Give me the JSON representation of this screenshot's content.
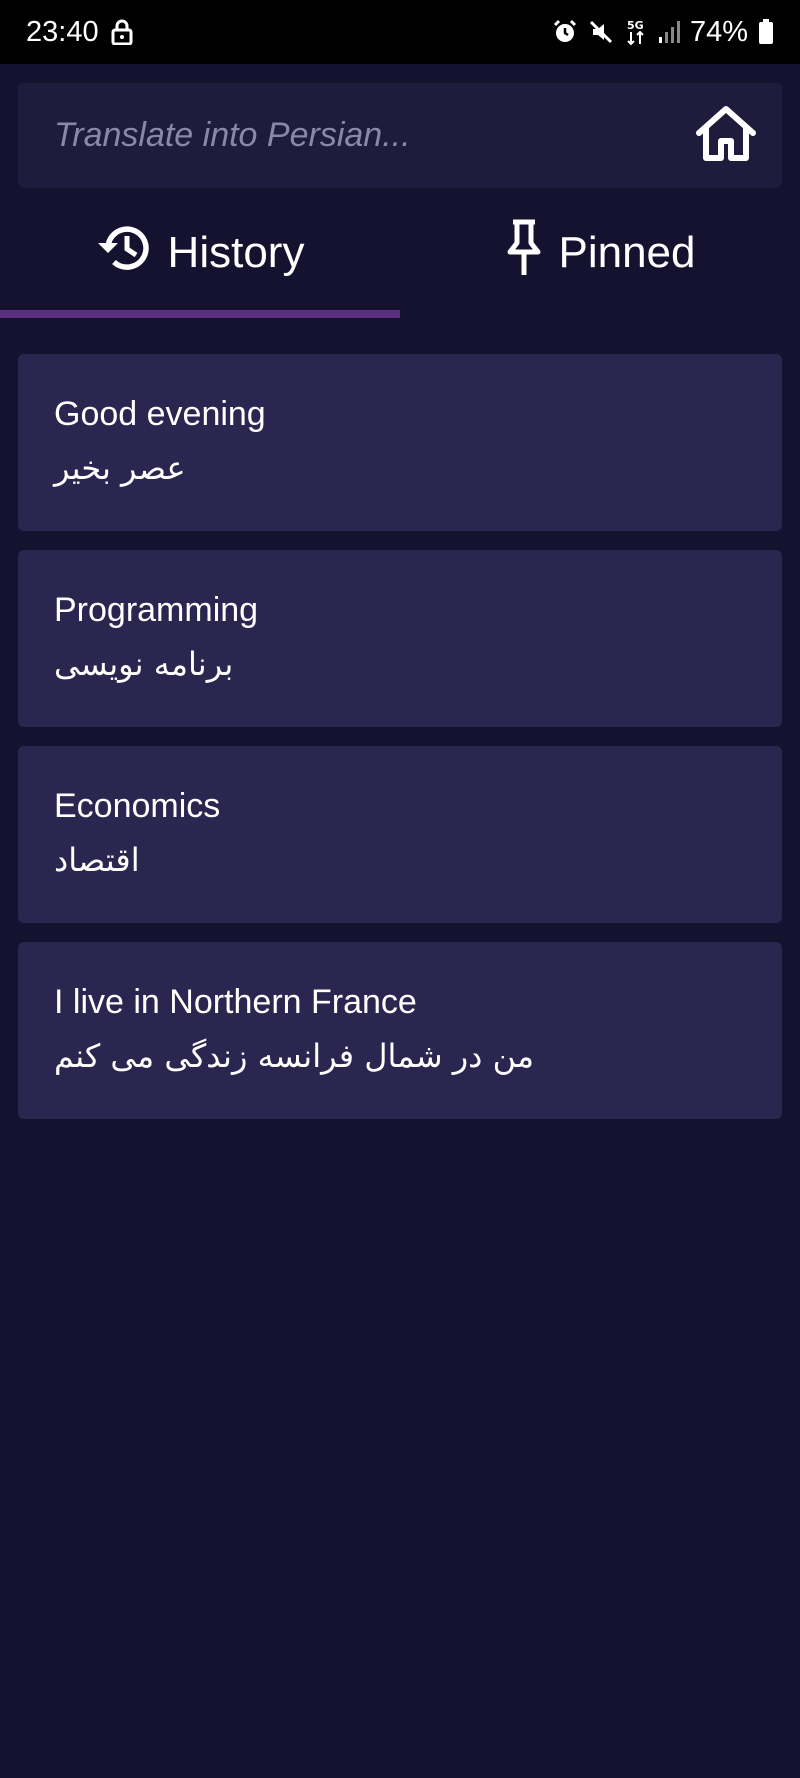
{
  "status_bar": {
    "time": "23:40",
    "battery": "74%",
    "icons": [
      "lock-icon",
      "alarm-icon",
      "mute-icon",
      "5g-icon",
      "signal-icon",
      "battery-icon"
    ]
  },
  "search": {
    "placeholder": "Translate into Persian...",
    "value": ""
  },
  "tabs": [
    {
      "label": "History",
      "icon": "history-icon",
      "selected": true
    },
    {
      "label": "Pinned",
      "icon": "pin-icon",
      "selected": false
    }
  ],
  "history": [
    {
      "source": "Good evening",
      "translation": "عصر بخیر"
    },
    {
      "source": "Programming",
      "translation": "برنامه نویسی"
    },
    {
      "source": "Economics",
      "translation": "اقتصاد"
    },
    {
      "source": "I live in Northern France",
      "translation": "من در شمال فرانسه زندگی می کنم"
    }
  ],
  "colors": {
    "background": "#151230",
    "card": "#2b2650",
    "search_bar": "#1f1b3d",
    "tab_indicator": "#5a2f7e",
    "status_bar": "#000000"
  }
}
